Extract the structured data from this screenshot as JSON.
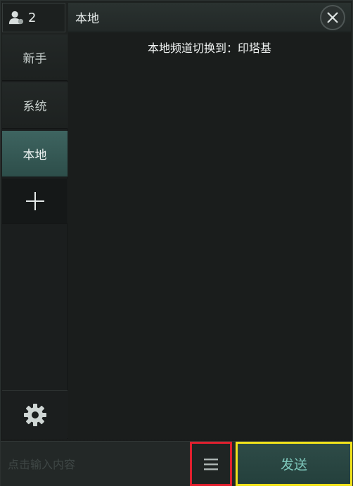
{
  "header": {
    "online_count": "2",
    "channel_title": "本地"
  },
  "sidebar": {
    "tabs": [
      {
        "label": "新手"
      },
      {
        "label": "系统"
      },
      {
        "label": "本地"
      }
    ]
  },
  "messages": [
    {
      "text": "本地频道切换到：印塔基"
    }
  ],
  "input": {
    "value": "",
    "placeholder": "点击输入内容"
  },
  "buttons": {
    "send_label": "发送"
  },
  "colors": {
    "active_tab": "#3e6460",
    "menu_highlight": "#e0202e",
    "send_highlight": "#f0e21b",
    "send_text": "#7fc9bd"
  },
  "icons": [
    "user-icon",
    "close-icon",
    "plus-icon",
    "gear-icon",
    "menu-icon"
  ]
}
